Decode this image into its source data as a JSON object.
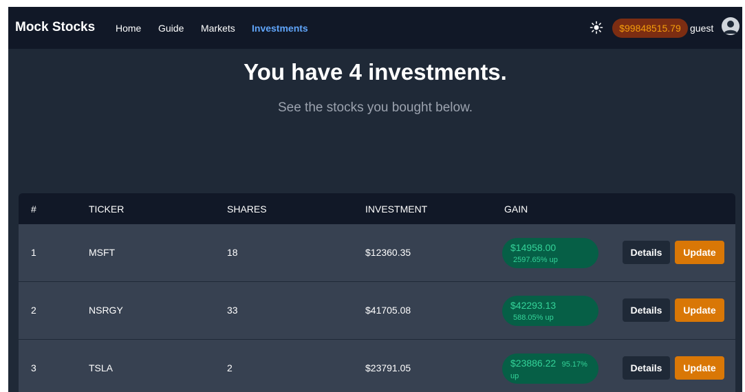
{
  "nav": {
    "brand": "Mock Stocks",
    "links": [
      "Home",
      "Guide",
      "Markets",
      "Investments"
    ],
    "active": "Investments",
    "balance": "$99848515.79",
    "username": "guest",
    "theme_icon": "sun-icon",
    "avatar_icon": "user-icon"
  },
  "hero": {
    "title": "You have 4 investments.",
    "subtitle": "See the stocks you bought below."
  },
  "table": {
    "headers": [
      "#",
      "TICKER",
      "SHARES",
      "INVESTMENT",
      "GAIN"
    ],
    "details_label": "Details",
    "update_label": "Update",
    "rows": [
      {
        "num": "1",
        "ticker": "MSFT",
        "shares": "18",
        "investment": "$12360.35",
        "gain": "$14958.00",
        "gain_pct": "2597.65% up"
      },
      {
        "num": "2",
        "ticker": "NSRGY",
        "shares": "33",
        "investment": "$41705.08",
        "gain": "$42293.13",
        "gain_pct": "588.05% up"
      },
      {
        "num": "3",
        "ticker": "TSLA",
        "shares": "2",
        "investment": "$23791.05",
        "gain": "$23886.22",
        "gain_pct": "95.17% up"
      }
    ]
  },
  "colors": {
    "background": "#1f2937",
    "navbar": "#111827",
    "accent": "#60a5fa",
    "gain": "#34d399",
    "update": "#d97706"
  }
}
